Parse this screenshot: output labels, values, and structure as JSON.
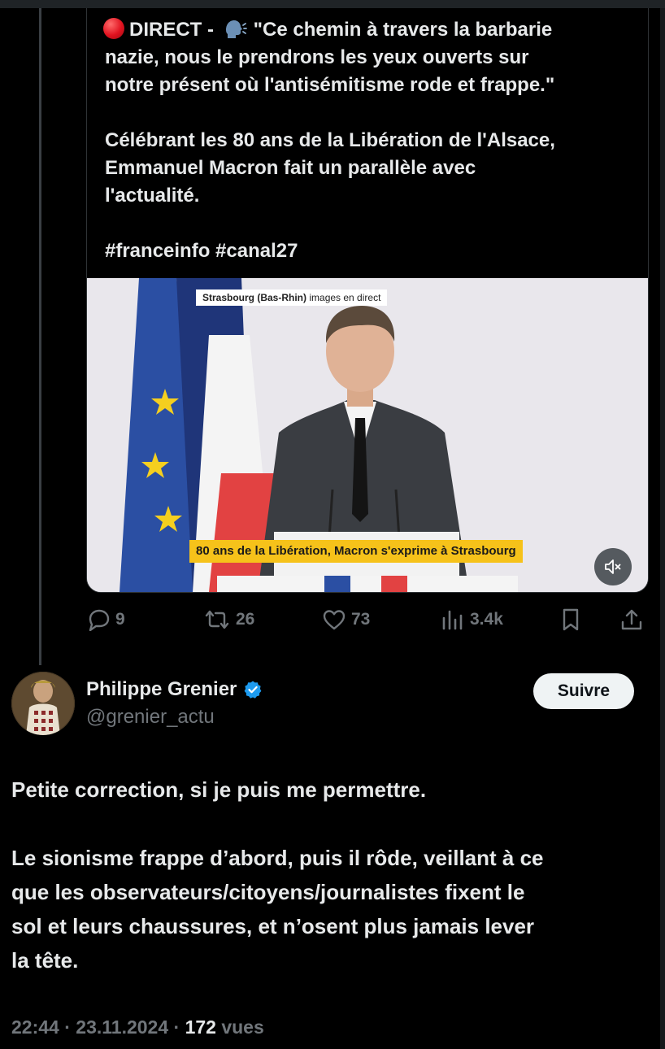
{
  "quoted_tweet": {
    "line1_prefix": "DIRECT -",
    "line1_quote_start": "\"Ce chemin à travers la barbarie",
    "line2": "nazie, nous le prendrons les yeux ouverts sur",
    "line3": "notre présent où l'antisémitisme rode et frappe.\"",
    "para2_line1": "Célébrant les 80 ans de la Libération de l'Alsace,",
    "para2_line2": "Emmanuel Macron fait un parallèle avec",
    "para2_line3": "l'actualité.",
    "hashtags": "#franceinfo #canal27",
    "video": {
      "location_bold": "Strasbourg (Bas-Rhin)",
      "location_suffix": "images en direct",
      "caption": "80 ans de la Libération, Macron s'exprime à Strasbourg",
      "mute_icon": "muted-speaker-icon"
    },
    "stats": {
      "replies": "9",
      "reposts": "26",
      "likes": "73",
      "views": "3.4k"
    }
  },
  "author": {
    "name": "Philippe Grenier",
    "handle": "@grenier_actu",
    "verified": true,
    "follow_label": "Suivre"
  },
  "tweet_text": {
    "p1": "Petite correction, si je puis me permettre.",
    "p2_l1": "Le sionisme frappe d’abord, puis il rôde, veillant à ce",
    "p2_l2": "que les observateurs/citoyens/journalistes fixent le",
    "p2_l3": "sol et leurs chaussures, et n’osent plus jamais lever",
    "p2_l4": "la tête."
  },
  "meta": {
    "time": "22:44",
    "date": "23.11.2024",
    "views_count": "172",
    "views_label": "vues"
  },
  "colors": {
    "background": "#000000",
    "text_primary": "#e7e9ea",
    "text_secondary": "#71767b",
    "verified_blue": "#1d9bf0",
    "caption_yellow": "#f6c21a"
  }
}
